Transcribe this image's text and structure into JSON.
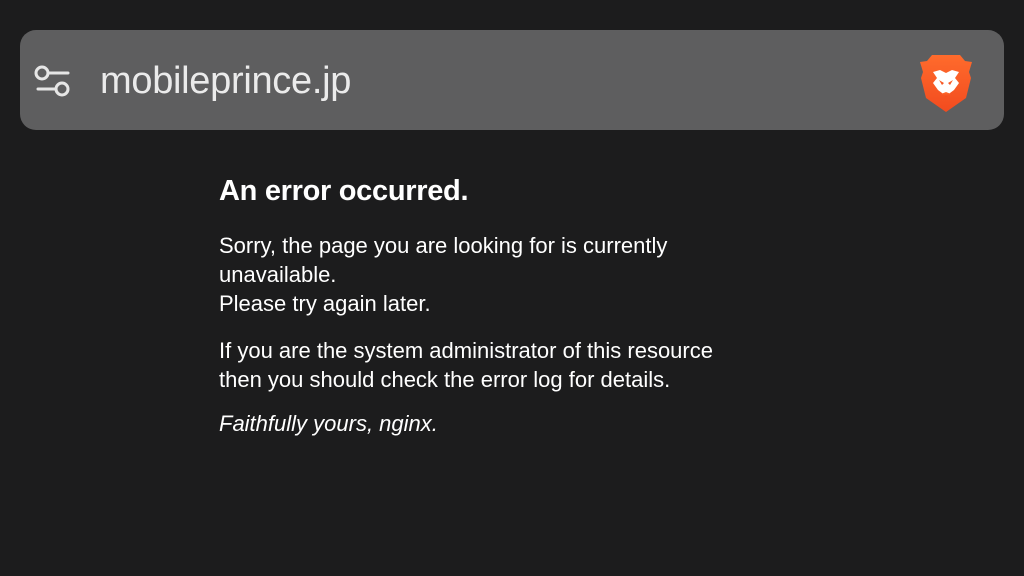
{
  "browser": {
    "url": "mobileprince.jp",
    "site_settings_icon": "sliders-icon",
    "brave_shields_icon": "brave-lion-icon",
    "brand_color": "#fb542b"
  },
  "page": {
    "heading": "An error occurred.",
    "paragraph1": {
      "line1": "Sorry, the page you are looking for is currently",
      "line2": "unavailable.",
      "line3": "Please try again later."
    },
    "paragraph2": {
      "line1": "If you are the system administrator of this resource",
      "line2": "then you should check the error log for details."
    },
    "signature": "Faithfully yours, nginx."
  }
}
